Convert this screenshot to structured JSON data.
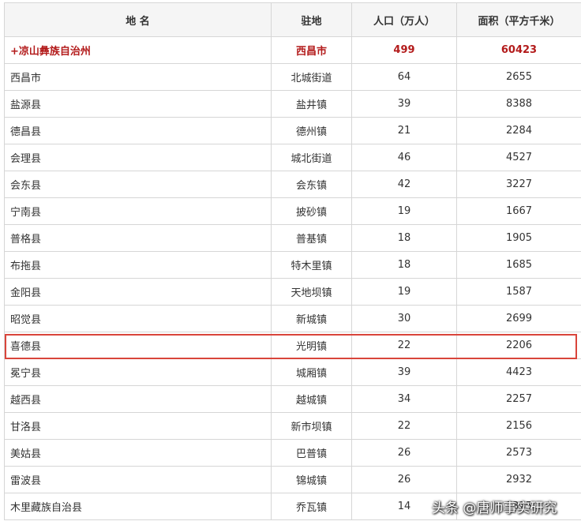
{
  "table": {
    "headers": [
      "地 名",
      "驻地",
      "人口（万人）",
      "面积（平方千米）"
    ],
    "summary": {
      "name": "+凉山彝族自治州",
      "seat": "西昌市",
      "population": "499",
      "area": "60423"
    },
    "rows": [
      {
        "name": "西昌市",
        "seat": "北城街道",
        "population": "64",
        "area": "2655"
      },
      {
        "name": "盐源县",
        "seat": "盐井镇",
        "population": "39",
        "area": "8388"
      },
      {
        "name": "德昌县",
        "seat": "德州镇",
        "population": "21",
        "area": "2284"
      },
      {
        "name": "会理县",
        "seat": "城北街道",
        "population": "46",
        "area": "4527"
      },
      {
        "name": "会东县",
        "seat": "会东镇",
        "population": "42",
        "area": "3227"
      },
      {
        "name": "宁南县",
        "seat": "披砂镇",
        "population": "19",
        "area": "1667"
      },
      {
        "name": "普格县",
        "seat": "普基镇",
        "population": "18",
        "area": "1905"
      },
      {
        "name": "布拖县",
        "seat": "特木里镇",
        "population": "18",
        "area": "1685"
      },
      {
        "name": "金阳县",
        "seat": "天地坝镇",
        "population": "19",
        "area": "1587"
      },
      {
        "name": "昭觉县",
        "seat": "新城镇",
        "population": "30",
        "area": "2699"
      },
      {
        "name": "喜德县",
        "seat": "光明镇",
        "population": "22",
        "area": "2206"
      },
      {
        "name": "冕宁县",
        "seat": "城厢镇",
        "population": "39",
        "area": "4423"
      },
      {
        "name": "越西县",
        "seat": "越城镇",
        "population": "34",
        "area": "2257"
      },
      {
        "name": "甘洛县",
        "seat": "新市坝镇",
        "population": "22",
        "area": "2156"
      },
      {
        "name": "美姑县",
        "seat": "巴普镇",
        "population": "26",
        "area": "2573"
      },
      {
        "name": "雷波县",
        "seat": "锦城镇",
        "population": "26",
        "area": "2932"
      },
      {
        "name": "木里藏族自治县",
        "seat": "乔瓦镇",
        "population": "14",
        "area": "1325"
      }
    ]
  },
  "highlighted_row": "喜德县",
  "highlight_color": "#d9453b",
  "summary_color": "#b31b1b",
  "watermark": "头条 @唐师事实研究"
}
